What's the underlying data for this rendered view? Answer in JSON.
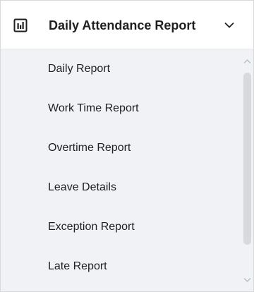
{
  "header": {
    "title": "Daily Attendance Report",
    "icon": "bar-chart-icon",
    "expand_icon": "chevron-down-icon"
  },
  "menu": {
    "items": [
      {
        "label": "Daily Report"
      },
      {
        "label": "Work Time Report"
      },
      {
        "label": "Overtime Report"
      },
      {
        "label": "Leave Details"
      },
      {
        "label": "Exception Report"
      },
      {
        "label": "Late Report"
      }
    ]
  },
  "colors": {
    "header_background": "#ffffff",
    "menu_background": "#f0f2f5",
    "text": "#1f1f1f",
    "scroll_thumb": "#d7d9dc"
  }
}
